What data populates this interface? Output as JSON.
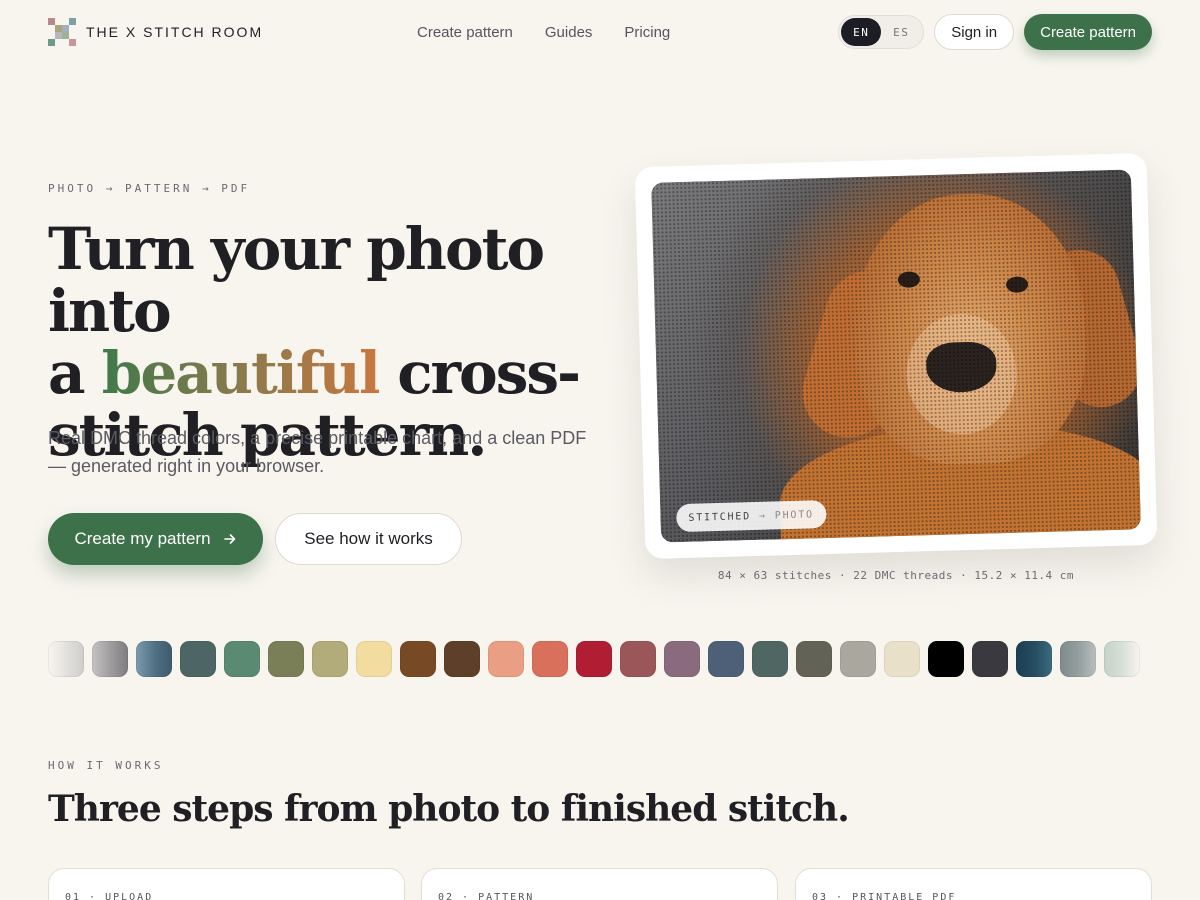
{
  "nav": {
    "brand": "THE X STITCH ROOM",
    "links": [
      "Create pattern",
      "Guides",
      "Pricing"
    ],
    "lang": [
      "EN",
      "ES"
    ],
    "lang_active": "EN",
    "sign_in": "Sign in",
    "cta": "Create pattern"
  },
  "hero": {
    "kicker": "PHOTO → PATTERN → PDF",
    "title_line1": "Turn your photo into",
    "title_a": "a",
    "title_accent": "beautiful",
    "title_rest": "cross-",
    "title_line3": "stitch pattern.",
    "subtitle": "Real DMC thread colors, a precise printable chart, and a clean PDF — generated right in your browser.",
    "primary_cta": "Create my pattern",
    "secondary_cta": "See how it works"
  },
  "preview": {
    "pill_left": "STITCHED",
    "pill_arrow": "→",
    "pill_right": "PHOTO",
    "caption": "84 × 63 stitches · 22 DMC threads · 15.2 × 11.4 cm"
  },
  "swatches": [
    "#e6e4e0",
    "#9c9a9c",
    "#4f6f82",
    "#4e6565",
    "#5b8a72",
    "#7b7f58",
    "#b2ab7a",
    "#f2dca0",
    "#774a25",
    "#5e3f2a",
    "#ea9f84",
    "#d8705c",
    "#b11d33",
    "#9b565a",
    "#8a6b7d",
    "#4d6077",
    "#4f6662",
    "#626257",
    "#aaa89e",
    "#e8e0c8",
    "#000000",
    "#3a393f",
    "#254c5f",
    "#939e9e",
    "#d6e0d6"
  ],
  "how": {
    "kicker": "HOW IT WORKS",
    "title": "Three steps from photo to finished stitch.",
    "steps": [
      "01 · UPLOAD",
      "02 · PATTERN",
      "03 · PRINTABLE PDF"
    ]
  },
  "colors": {
    "accent_green": "#3c7149",
    "background": "#f8f5ef",
    "ink": "#1f1f24"
  }
}
